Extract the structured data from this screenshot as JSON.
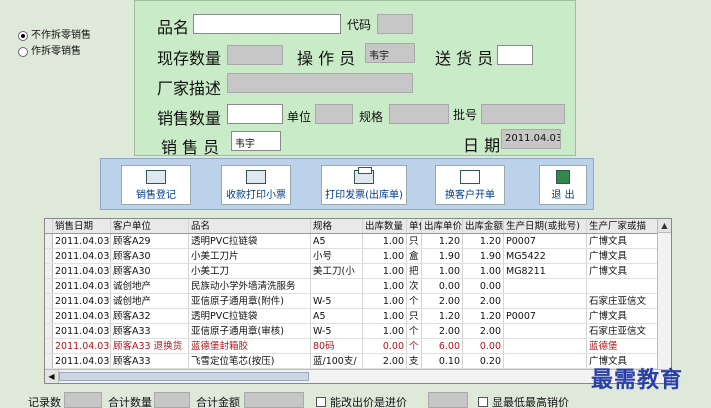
{
  "mode": {
    "options": [
      {
        "label": "不作拆零销售",
        "selected": true
      },
      {
        "label": "作拆零销售",
        "selected": false
      }
    ]
  },
  "form": {
    "product_name_label": "品名",
    "code_label": "代码",
    "stock_label": "现存数量",
    "operator_label": "操 作 员",
    "operator_value": "韦宇",
    "delivery_label": "送 货 员",
    "maker_label": "厂家描述",
    "qty_label": "销售数量",
    "unit_label": "单位",
    "spec_label": "规格",
    "batch_label": "批号",
    "seller_label": "销 售 员",
    "seller_value": "韦宇",
    "date_label": "日 期",
    "date_value": "2011.04.03"
  },
  "toolbar": {
    "register": "销售登记",
    "print_receipt": "收款打印小票",
    "print_invoice": "打印发票(出库单)",
    "change_customer": "换客户开单",
    "exit": "退 出"
  },
  "table": {
    "columns": [
      "销售日期",
      "客户单位",
      "品名",
      "规格",
      "出库数量",
      "单位",
      "出库单价",
      "出库金额",
      "生产日期(或批号)",
      "生产厂家或描"
    ],
    "rows": [
      [
        "2011.04.03",
        "顾客A29",
        "透明PVC拉链袋",
        "A5",
        "1.00",
        "只",
        "1.20",
        "1.20",
        "P0007",
        "广博文具"
      ],
      [
        "2011.04.03",
        "顾客A30",
        "小美工刀片",
        "小号",
        "1.00",
        "盒",
        "1.90",
        "1.90",
        "MG5422",
        "广博文具"
      ],
      [
        "2011.04.03",
        "顾客A30",
        "小美工刀",
        "美工刀(小",
        "1.00",
        "把",
        "1.00",
        "1.00",
        "MG8211",
        "广博文具"
      ],
      [
        "2011.04.03",
        "诚创地产",
        "民族动小学外墙清洗服务",
        "",
        "1.00",
        "次",
        "0.00",
        "0.00",
        "",
        ""
      ],
      [
        "2011.04.03",
        "诚创地产",
        "亚信原子通用章(附件)",
        "W-5",
        "1.00",
        "个",
        "2.00",
        "2.00",
        "",
        "石家庄亚信文"
      ],
      [
        "2011.04.03",
        "顾客A32",
        "透明PVC拉链袋",
        "A5",
        "1.00",
        "只",
        "1.20",
        "1.20",
        "P0007",
        "广博文具"
      ],
      [
        "2011.04.03",
        "顾客A33",
        "亚信原子通用章(审核)",
        "W-5",
        "1.00",
        "个",
        "2.00",
        "2.00",
        "",
        "石家庄亚信文"
      ],
      [
        "2011.04.03",
        "顾客A33 退换货",
        "蓝德堡封箱胶",
        "80码",
        "0.00",
        "个",
        "6.00",
        "0.00",
        "",
        "蓝德堡"
      ],
      [
        "2011.04.03",
        "顾客A33",
        "飞雪定位笔芯(按压)",
        "蓝/100支/",
        "2.00",
        "支",
        "0.10",
        "0.20",
        "",
        "广博文具"
      ]
    ],
    "red_row_index": 7
  },
  "footer": {
    "record_count": "记录数",
    "total_qty": "合计数量",
    "total_amount": "合计金额",
    "allow_modify_price": "能改出价是进价",
    "show_min_price": "显最低最高销价"
  },
  "watermark": "最需教育",
  "colors": {
    "form_bg": "#c9ebc7",
    "toolbar_bg": "#bcd1ea",
    "body_bg": "#dfe9d9",
    "link_blue": "#003b8c",
    "red_text": "#b0141e"
  }
}
